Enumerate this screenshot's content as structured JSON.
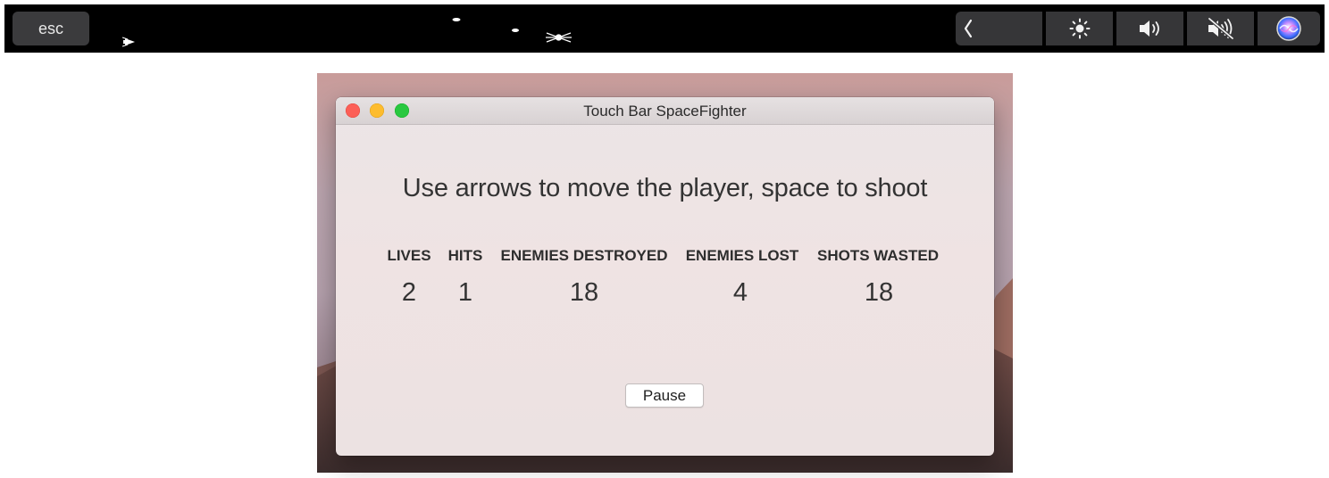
{
  "touch_bar": {
    "esc_label": "esc",
    "control_strip": {
      "collapse_icon": "chevron-left-icon",
      "brightness_icon": "brightness-icon",
      "volume_icon": "volume-icon",
      "mute_icon": "mute-icon",
      "siri_icon": "siri-icon"
    }
  },
  "window": {
    "title": "Touch Bar SpaceFighter",
    "instructions": "Use arrows to move the player, space to shoot",
    "stats": [
      {
        "label": "LIVES",
        "value": "2"
      },
      {
        "label": "HITS",
        "value": "1"
      },
      {
        "label": "ENEMIES DESTROYED",
        "value": "18"
      },
      {
        "label": "ENEMIES LOST",
        "value": "4"
      },
      {
        "label": "SHOTS WASTED",
        "value": "18"
      }
    ],
    "pause_label": "Pause"
  },
  "colors": {
    "close": "#fc5f57",
    "minimize": "#fdbc2e",
    "maximize": "#29c840"
  }
}
